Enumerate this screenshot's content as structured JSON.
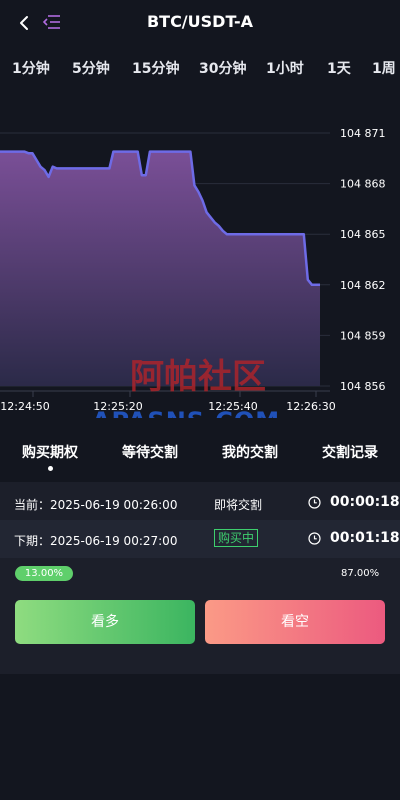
{
  "header": {
    "title": "BTC/USDT-A",
    "back_icon": "chevron-left-icon",
    "menu_icon": "menu-lines-icon"
  },
  "intervals": [
    {
      "label": "1分钟",
      "active": true
    },
    {
      "label": "5分钟",
      "active": false
    },
    {
      "label": "15分钟",
      "active": false
    },
    {
      "label": "30分钟",
      "active": false
    },
    {
      "label": "1小时",
      "active": false
    },
    {
      "label": "1天",
      "active": false
    },
    {
      "label": "1周",
      "active": false
    }
  ],
  "chart_data": {
    "type": "area",
    "x_ticks": [
      "12:24:50",
      "12:25:20",
      "12:25:40",
      "12:26:30"
    ],
    "y_ticks": [
      "104 871",
      "104 868",
      "104 865",
      "104 862",
      "104 859",
      "104 856"
    ],
    "ylim": [
      104856,
      104871
    ],
    "grid": true,
    "line_color": "#6e6be6",
    "fill_top_color": "#7a4f97",
    "fill_bottom_color": "#2b2a48",
    "series": [
      {
        "values": [
          104869.9,
          104869.9,
          104869.9,
          104869.9,
          104869.9,
          104869.9,
          104869.9,
          104869.8,
          104869.8,
          104869.4,
          104869.0,
          104868.8,
          104868.4,
          104869.0,
          104868.9,
          104868.9,
          104868.9,
          104868.9,
          104868.9,
          104868.9,
          104868.9,
          104868.9,
          104868.9,
          104868.9,
          104868.9,
          104868.9,
          104868.9,
          104868.9,
          104869.9,
          104869.9,
          104869.9,
          104869.9,
          104869.9,
          104869.9,
          104869.9,
          104868.5,
          104868.5,
          104869.9,
          104869.9,
          104869.9,
          104869.9,
          104869.9,
          104869.9,
          104869.9,
          104869.9,
          104869.9,
          104869.9,
          104869.9,
          104867.9,
          104867.5,
          104867.0,
          104866.3,
          104866.0,
          104865.7,
          104865.5,
          104865.2,
          104865.0,
          104865.0,
          104865.0,
          104865.0,
          104865.0,
          104865.0,
          104865.0,
          104865.0,
          104865.0,
          104865.0,
          104865.0,
          104865.0,
          104865.0,
          104865.0,
          104865.0,
          104865.0,
          104865.0,
          104865.0,
          104865.0,
          104865.0,
          104862.3,
          104862.0,
          104862.0,
          104862.0
        ]
      }
    ]
  },
  "watermark": {
    "cn": "阿帕社区",
    "en": "APASNS.COM"
  },
  "trade_tabs": [
    {
      "label": "购买期权",
      "active": true
    },
    {
      "label": "等待交割",
      "active": false
    },
    {
      "label": "我的交割",
      "active": false
    },
    {
      "label": "交割记录",
      "active": false
    }
  ],
  "current_period": {
    "label": "当前：2025-06-19 00:26:00",
    "status": "即将交割",
    "countdown": "00:00:18"
  },
  "next_period": {
    "label": "下期：2025-06-19 00:27:00",
    "status": "购买中",
    "countdown": "00:01:18"
  },
  "ratio": {
    "long_percent": "13.00%",
    "short_percent": "87.00%",
    "long_color": "#5fcf6b"
  },
  "buttons": {
    "long_label": "看多",
    "short_label": "看空"
  }
}
